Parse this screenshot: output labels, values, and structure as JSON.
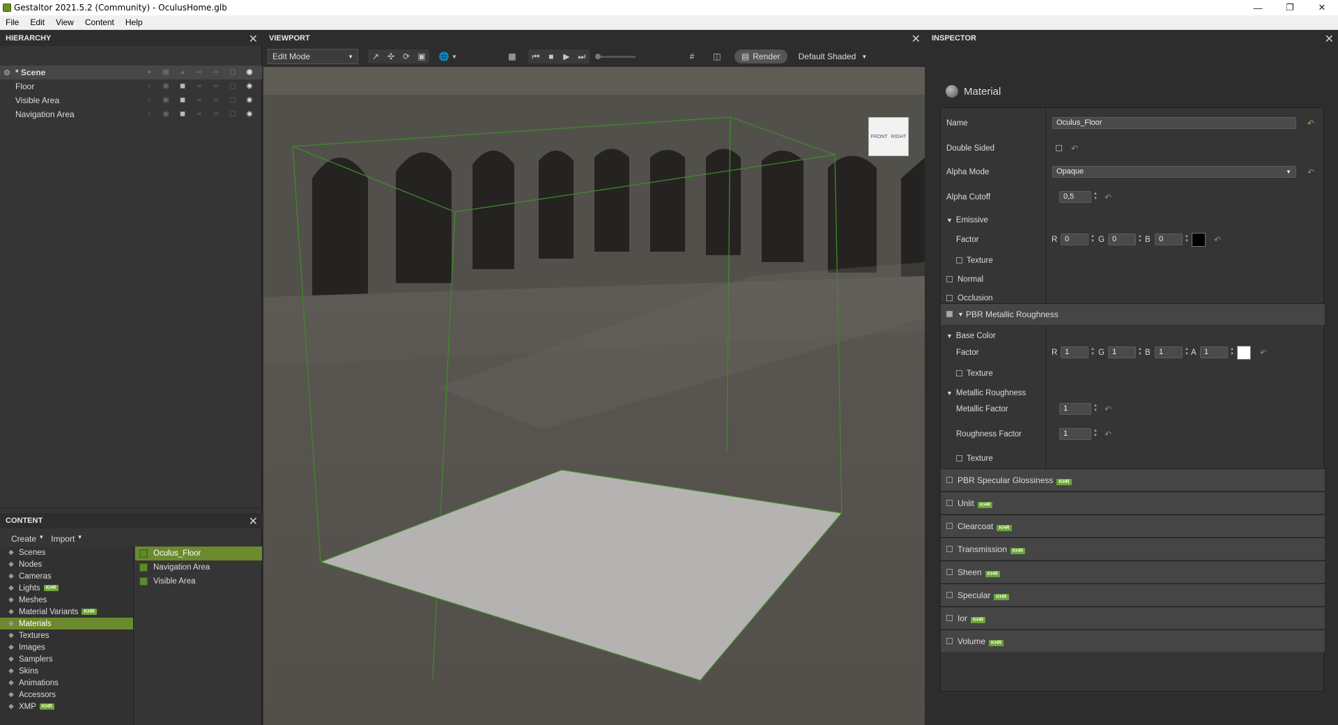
{
  "window": {
    "title": "Gestaltor 2021.5.2 (Community) - OculusHome.glb"
  },
  "menu": [
    "File",
    "Edit",
    "View",
    "Content",
    "Help"
  ],
  "hierarchy": {
    "title": "HIERARCHY",
    "scene_label": "* Scene",
    "items": [
      "Floor",
      "Visible Area",
      "Navigation Area"
    ]
  },
  "content": {
    "title": "CONTENT",
    "create_label": "Create",
    "import_label": "Import",
    "categories": [
      {
        "label": "Scenes",
        "khr": false
      },
      {
        "label": "Nodes",
        "khr": false
      },
      {
        "label": "Cameras",
        "khr": false
      },
      {
        "label": "Lights",
        "khr": true
      },
      {
        "label": "Meshes",
        "khr": false
      },
      {
        "label": "Material Variants",
        "khr": true
      },
      {
        "label": "Materials",
        "khr": false,
        "selected": true
      },
      {
        "label": "Textures",
        "khr": false
      },
      {
        "label": "Images",
        "khr": false
      },
      {
        "label": "Samplers",
        "khr": false
      },
      {
        "label": "Skins",
        "khr": false
      },
      {
        "label": "Animations",
        "khr": false
      },
      {
        "label": "Accessors",
        "khr": false
      },
      {
        "label": "XMP",
        "khr": true
      }
    ],
    "khr_badge": "KHR",
    "materials": [
      "Oculus_Floor",
      "Navigation Area",
      "Visible Area"
    ]
  },
  "viewport": {
    "title": "VIEWPORT",
    "mode": "Edit Mode",
    "render_label": "Render",
    "shading": "Default Shaded",
    "cube_front": "FRONT",
    "cube_right": "RIGHT"
  },
  "inspector": {
    "title": "INSPECTOR",
    "material_heading": "Material",
    "name_label": "Name",
    "name_value": "Oculus_Floor",
    "double_sided_label": "Double Sided",
    "alpha_mode_label": "Alpha Mode",
    "alpha_mode_value": "Opaque",
    "alpha_cutoff_label": "Alpha Cutoff",
    "alpha_cutoff_value": "0,5",
    "emissive_label": "Emissive",
    "factor_label": "Factor",
    "r": "R",
    "g": "G",
    "b": "B",
    "a": "A",
    "emissive_r": "0",
    "emissive_g": "0",
    "emissive_b": "0",
    "texture_label": "Texture",
    "normal_label": "Normal",
    "occlusion_label": "Occlusion",
    "pbr_label": "PBR Metallic Roughness",
    "base_color_label": "Base Color",
    "base_r": "1",
    "base_g": "1",
    "base_b": "1",
    "base_a": "1",
    "metallic_roughness_label": "Metallic Roughness",
    "metallic_factor_label": "Metallic Factor",
    "metallic_factor_value": "1",
    "roughness_factor_label": "Roughness Factor",
    "roughness_factor_value": "1",
    "extensions": [
      "PBR Specular Glossiness",
      "Unlit",
      "Clearcoat",
      "Transmission",
      "Sheen",
      "Specular",
      "Ior",
      "Volume"
    ],
    "emissive_color": "#000000",
    "base_color": "#ffffff"
  },
  "colors": {
    "accent": "#6c8a2e",
    "khr": "#6ea23a"
  }
}
